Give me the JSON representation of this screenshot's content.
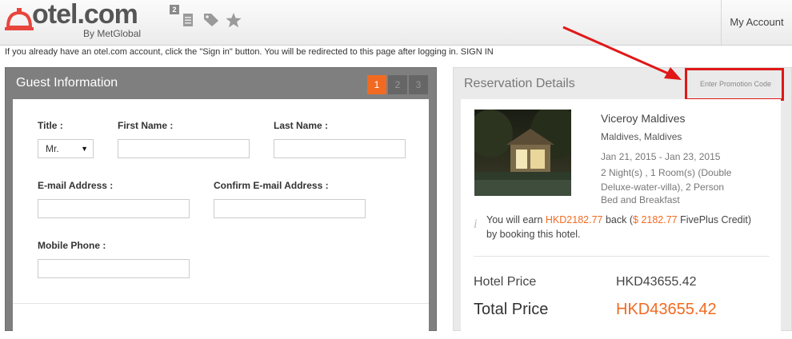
{
  "header": {
    "logo_text": "otel.com",
    "logo_sub": "By MetGlobal",
    "badge_count": "2",
    "icons": [
      "document-icon",
      "tag-icon",
      "star-icon"
    ],
    "account_label": "My Account"
  },
  "notice": {
    "text": "If you already have an otel.com account, click the \"Sign in\" button. You will be redirected to this page after logging in.",
    "signin": "SIGN IN"
  },
  "guest": {
    "title": "Guest Information",
    "steps": [
      "1",
      "2",
      "3"
    ],
    "active_step": "1",
    "labels": {
      "title": "Title :",
      "first_name": "First Name :",
      "last_name": "Last Name :",
      "email": "E-mail Address :",
      "confirm_email": "Confirm E-mail Address :",
      "mobile": "Mobile Phone :"
    },
    "title_value": "Mr."
  },
  "reservation": {
    "title": "Reservation Details",
    "promo": "Enter Promotion Code",
    "hotel_name": "Viceroy Maldives",
    "location": "Maldives, Maldives",
    "dates": "Jan 21, 2015 - Jan 23, 2015",
    "rooms": "2 Night(s) , 1 Room(s) (Double Deluxe-water-villa), 2 Person",
    "board": "Bed and Breakfast",
    "earn_prefix": "You will earn",
    "earn_amount": "HKD2182.77",
    "earn_mid": "back (",
    "earn_credit": "$ 2182.77",
    "earn_suffix": "FivePlus Credit)",
    "earn_line2": "by booking this hotel.",
    "hotel_price_label": "Hotel Price",
    "hotel_price": "HKD43655.42",
    "total_price_label": "Total Price",
    "total_price": "HKD43655.42"
  },
  "colors": {
    "accent": "#f26a21",
    "annotation": "#e01818",
    "panel_header": "#7f7f7f"
  }
}
